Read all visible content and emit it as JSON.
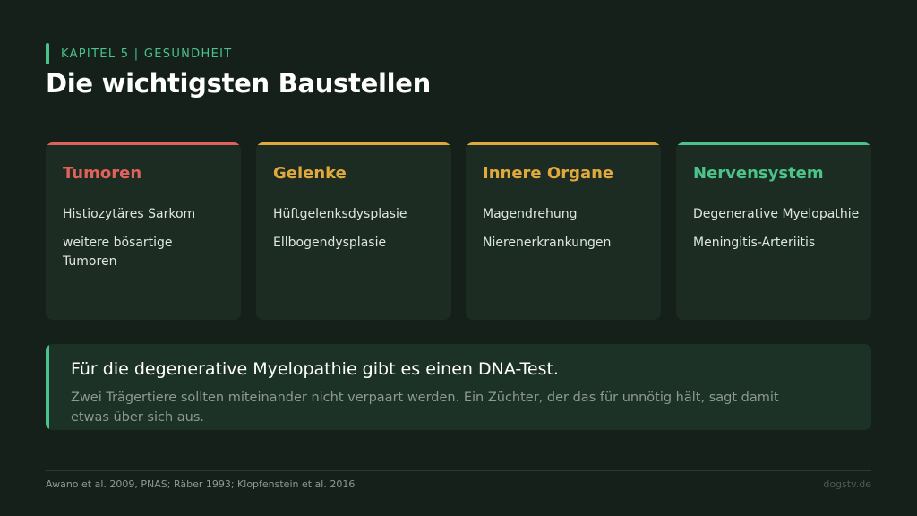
{
  "colors": {
    "accent": "#4cc38a",
    "tumoren": "#e0625a",
    "gelenke": "#e0a93b",
    "organe": "#e0a93b",
    "nerven": "#4cc38a"
  },
  "header": {
    "kicker": "KAPITEL 5 | GESUNDHEIT",
    "title": "Die wichtigsten Baustellen"
  },
  "cards": [
    {
      "title": "Tumoren",
      "items": [
        "Histiozytäres Sarkom",
        "weitere bösartige Tumoren"
      ]
    },
    {
      "title": "Gelenke",
      "items": [
        "Hüftgelenksdysplasie",
        "Ellbogendysplasie"
      ]
    },
    {
      "title": "Innere Organe",
      "items": [
        "Magendrehung",
        "Nierenerkrankungen"
      ]
    },
    {
      "title": "Nervensystem",
      "items": [
        "Degenerative Myelopathie",
        "Meningitis-Arteriitis"
      ]
    }
  ],
  "callout": {
    "headline": "Für die degenerative Myelopathie gibt es einen DNA-Test.",
    "body": "Zwei Trägertiere sollten miteinander nicht verpaart werden. Ein Züchter, der das für unnötig hält, sagt damit etwas über sich aus."
  },
  "footer": {
    "sources": "Awano et al. 2009, PNAS; Räber 1993; Klopfenstein et al. 2016",
    "brand": "dogstv.de"
  }
}
